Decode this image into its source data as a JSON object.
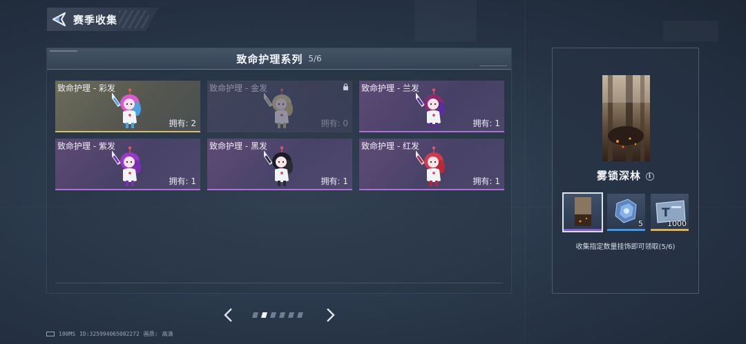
{
  "header": {
    "title": "赛季收集",
    "back_icon": "back-arrow-icon"
  },
  "series": {
    "title": "致命护理系列",
    "count": "5/6"
  },
  "cards": [
    {
      "name": "致命护理 - 彩发",
      "owned_label": "拥有: 2",
      "state": "gold",
      "hair": "#d95bd0",
      "hair2": "#4aa3e0"
    },
    {
      "name": "致命护理 - 金发",
      "owned_label": "拥有: 0",
      "state": "locked",
      "hair": "#d7c98a",
      "hair2": "#c8b878"
    },
    {
      "name": "致命护理 - 兰发",
      "owned_label": "拥有: 1",
      "state": "purple",
      "hair": "#8c2a6e",
      "hair2": "#5b2f9a"
    },
    {
      "name": "致命护理 - 紫发",
      "owned_label": "拥有: 1",
      "state": "purple",
      "hair": "#9b39c9",
      "hair2": "#7b2fb3"
    },
    {
      "name": "致命护理 - 黑发",
      "owned_label": "拥有: 1",
      "state": "purple",
      "hair": "#1c1c24",
      "hair2": "#2b2b36"
    },
    {
      "name": "致命护理 - 红发",
      "owned_label": "拥有: 1",
      "state": "purple",
      "hair": "#d23a4a",
      "hair2": "#b52a3a"
    }
  ],
  "pager": {
    "total": 6,
    "active_index": 1
  },
  "reward": {
    "title": "雾锁深林",
    "description": "收集指定数量挂饰即可领取(5/6)",
    "slots": [
      {
        "icon": "forest-skin-icon",
        "count": "",
        "rarity": "purple"
      },
      {
        "icon": "crate-icon",
        "count": "5",
        "rarity": "blue"
      },
      {
        "icon": "ticket-icon",
        "count": "1000",
        "rarity": "gold"
      }
    ]
  },
  "status": {
    "ping": "100MS",
    "id": "ID:325994065082272",
    "quality_label": "画质:",
    "quality_value": "高清"
  },
  "colors": {
    "accent_purple": "#b070d8",
    "accent_gold": "#d8c06a",
    "accent_blue": "#4b95d8"
  }
}
